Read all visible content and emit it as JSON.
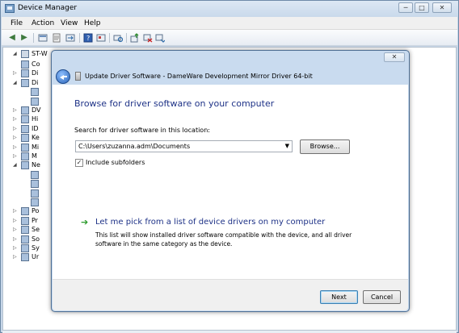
{
  "window": {
    "title": "Device Manager",
    "controls": {
      "minimize": "─",
      "maximize": "□",
      "close": "✕"
    }
  },
  "menu": [
    "File",
    "Action",
    "View",
    "Help"
  ],
  "toolbar_icons": [
    "back-arrow-icon",
    "forward-arrow-icon",
    "device-view-icon",
    "properties-icon",
    "export-icon",
    "help-icon",
    "resources-icon",
    "scan-hardware-icon",
    "update-driver-icon",
    "disable-device-icon",
    "uninstall-device-icon"
  ],
  "tree": {
    "root": "ST-W",
    "rows": [
      {
        "indent": 1,
        "label": "Co",
        "expander": ""
      },
      {
        "indent": 1,
        "label": "Di",
        "expander": "▷"
      },
      {
        "indent": 1,
        "label": "Di",
        "expander": "◢"
      },
      {
        "indent": 2,
        "label": "",
        "expander": ""
      },
      {
        "indent": 2,
        "label": "",
        "expander": ""
      },
      {
        "indent": 1,
        "label": "DV",
        "expander": "▷"
      },
      {
        "indent": 1,
        "label": "Hi",
        "expander": "▷"
      },
      {
        "indent": 1,
        "label": "ID",
        "expander": "▷"
      },
      {
        "indent": 1,
        "label": "Ke",
        "expander": "▷"
      },
      {
        "indent": 1,
        "label": "Mi",
        "expander": "▷"
      },
      {
        "indent": 1,
        "label": "M",
        "expander": "▷"
      },
      {
        "indent": 1,
        "label": "Ne",
        "expander": "◢"
      },
      {
        "indent": 2,
        "label": "",
        "expander": ""
      },
      {
        "indent": 2,
        "label": "",
        "expander": ""
      },
      {
        "indent": 2,
        "label": "",
        "expander": ""
      },
      {
        "indent": 2,
        "label": "",
        "expander": ""
      },
      {
        "indent": 1,
        "label": "Po",
        "expander": "▷"
      },
      {
        "indent": 1,
        "label": "Pr",
        "expander": "▷"
      },
      {
        "indent": 1,
        "label": "Se",
        "expander": "▷"
      },
      {
        "indent": 1,
        "label": "So",
        "expander": "▷"
      },
      {
        "indent": 1,
        "label": "Sy",
        "expander": "▷"
      },
      {
        "indent": 1,
        "label": "Ur",
        "expander": "▷"
      }
    ]
  },
  "dialog": {
    "title": "Update Driver Software - DameWare Development Mirror Driver 64-bit",
    "close_label": "✕",
    "instruction": "Browse for driver software on your computer",
    "location_label": "Search for driver software in this location:",
    "path_value": "C:\\Users\\zuzanna.adm\\Documents",
    "browse_label": "Browse...",
    "include_subfolders_label": "Include subfolders",
    "include_subfolders_checked": true,
    "pick_link": "Let me pick from a list of device drivers on my computer",
    "pick_description": "This list will show installed driver software compatible with the device, and all driver software in the same category as the device.",
    "next_label": "Next",
    "cancel_label": "Cancel"
  },
  "colors": {
    "instruction_blue": "#1e3287",
    "link_arrow_green": "#2a9a2a",
    "chrome_blue": "#c7d6e8"
  }
}
